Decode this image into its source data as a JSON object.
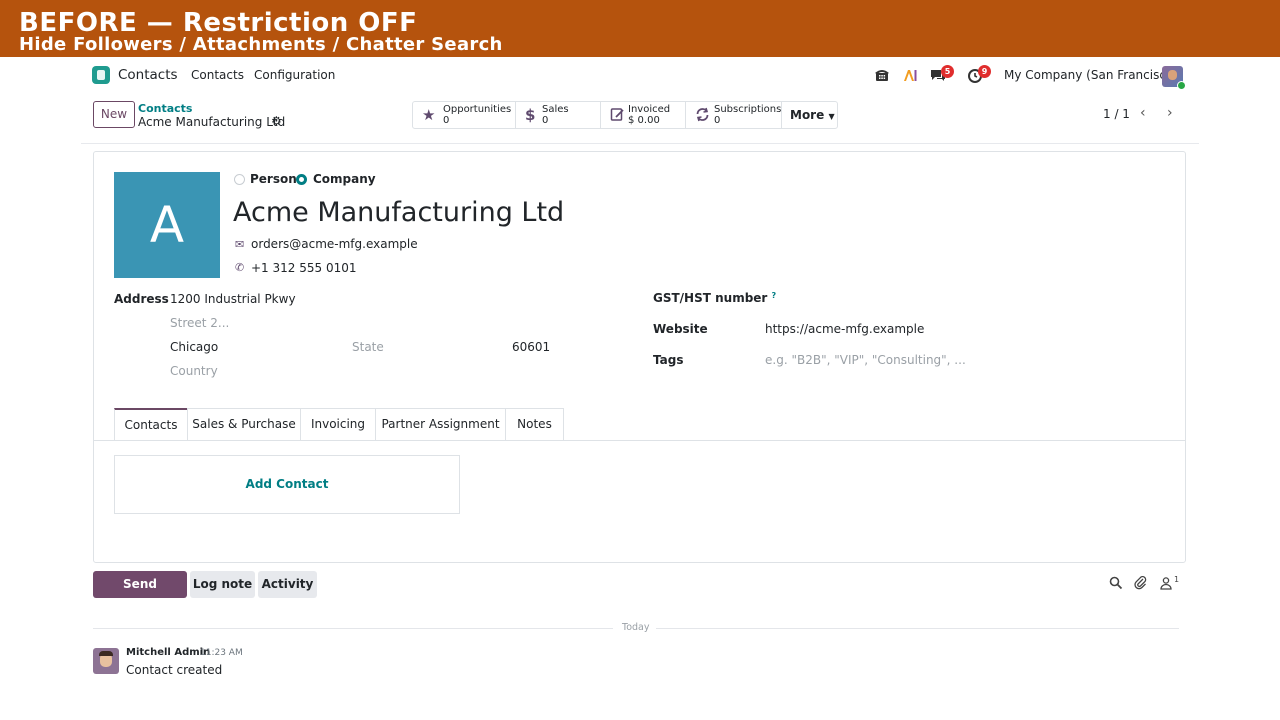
{
  "banner": {
    "title": "BEFORE — Restriction OFF",
    "subtitle": "Hide Followers / Attachments / Chatter Search",
    "color": "#b5530d"
  },
  "navbar": {
    "app_name": "Contacts",
    "menu": [
      "Contacts",
      "Configuration"
    ],
    "icons": [
      "phone-icon",
      "ai-icon",
      "chat-icon",
      "activity-clock-icon"
    ],
    "chat_badge": "5",
    "activity_badge": "9",
    "company": "My Company (San Francisco)"
  },
  "control_panel": {
    "new_label": "New",
    "breadcrumb_parent": "Contacts",
    "breadcrumb_current": "Acme Manufacturing Ltd",
    "smart_buttons": [
      {
        "label": "Opportunities",
        "value": "0",
        "icon": "star-icon"
      },
      {
        "label": "Sales",
        "value": "0",
        "icon": "dollar-icon"
      },
      {
        "label": "Invoiced",
        "value": "$ 0.00",
        "icon": "invoice-icon"
      },
      {
        "label": "Subscriptions",
        "value": "0",
        "icon": "refresh-icon"
      }
    ],
    "more_label": "More",
    "pager": "1 / 1"
  },
  "form": {
    "avatar_letter": "A",
    "avatar_color": "#3a95b4",
    "type_options": [
      "Person",
      "Company"
    ],
    "type_selected": "Company",
    "name": "Acme Manufacturing Ltd",
    "email": "orders@acme-mfg.example",
    "phone": "+1 312 555 0101",
    "address_label": "Address",
    "street": "1200 Industrial Pkwy",
    "street2_placeholder": "Street 2...",
    "city": "Chicago",
    "state_placeholder": "State",
    "zip": "60601",
    "country_placeholder": "Country",
    "gst_label": "GST/HST number",
    "gst_help": "?",
    "website_label": "Website",
    "website": "https://acme-mfg.example",
    "tags_label": "Tags",
    "tags_placeholder": "e.g. \"B2B\", \"VIP\", \"Consulting\", ...",
    "tabs": [
      "Contacts",
      "Sales & Purchase",
      "Invoicing",
      "Partner Assignment",
      "Notes"
    ],
    "active_tab": "Contacts",
    "add_contact": "Add Contact"
  },
  "chatter": {
    "send_message": "Send message",
    "log_note": "Log note",
    "activity": "Activity",
    "followers_count": "1",
    "date_separator": "Today",
    "messages": [
      {
        "author": "Mitchell Admin",
        "time": "11:23 AM",
        "body": "Contact created"
      }
    ]
  }
}
